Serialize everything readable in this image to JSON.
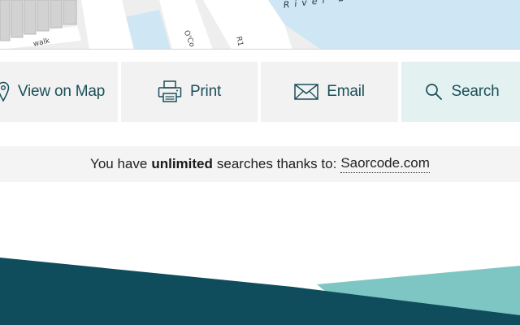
{
  "map": {
    "river_label": "River Liffey",
    "walk_label": "walk",
    "oco_label": "O'Co",
    "road_label": "R1",
    "colors": {
      "land": "#eeeeee",
      "water": "#cfe6f5",
      "road": "#ffffff",
      "building": "#d0d0d0"
    }
  },
  "actions": {
    "view_on_map": {
      "label": "View on Map",
      "icon": "map-pin-icon"
    },
    "print": {
      "label": "Print",
      "icon": "printer-icon"
    },
    "email": {
      "label": "Email",
      "icon": "envelope-icon"
    },
    "search": {
      "label": "Search",
      "icon": "search-icon"
    }
  },
  "info": {
    "prefix": "You have",
    "emphasis": "unlimited",
    "suffix": "searches thanks to:",
    "link_text": "Saorcode.com"
  },
  "colors": {
    "accent": "#1b4f5a",
    "footer_dark": "#0f4c5c",
    "footer_light": "#7ec6c3",
    "action_bg": "#f2f2f2",
    "search_bg": "#e3f1f1"
  }
}
